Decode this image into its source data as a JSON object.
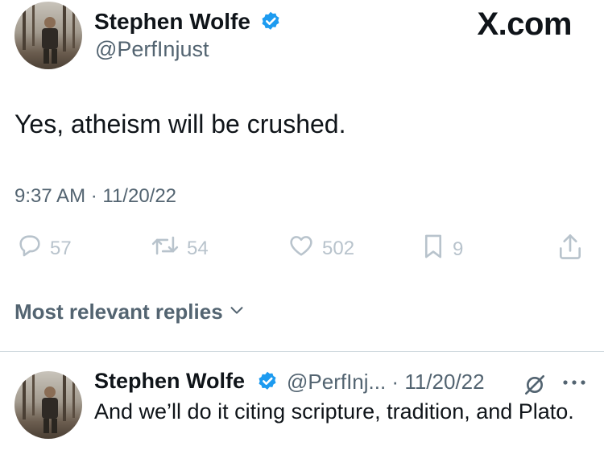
{
  "watermark": "X.com",
  "main_tweet": {
    "author_name": "Stephen Wolfe",
    "handle": "@PerfInjust",
    "text": "Yes, atheism will be crushed.",
    "timestamp": "9:37 AM · 11/20/22",
    "stats": {
      "replies": "57",
      "reposts": "54",
      "likes": "502",
      "bookmarks": "9"
    }
  },
  "replies_filter": {
    "label": "Most relevant replies"
  },
  "reply": {
    "author_name": "Stephen Wolfe",
    "handle_date": "@PerfInj... · 11/20/22",
    "text": "And we’ll do it citing scripture, tradition, and Plato."
  },
  "colors": {
    "verified_badge": "#1d9bf0",
    "muted_text": "#536471",
    "faded_icon": "#b8c3cc"
  }
}
